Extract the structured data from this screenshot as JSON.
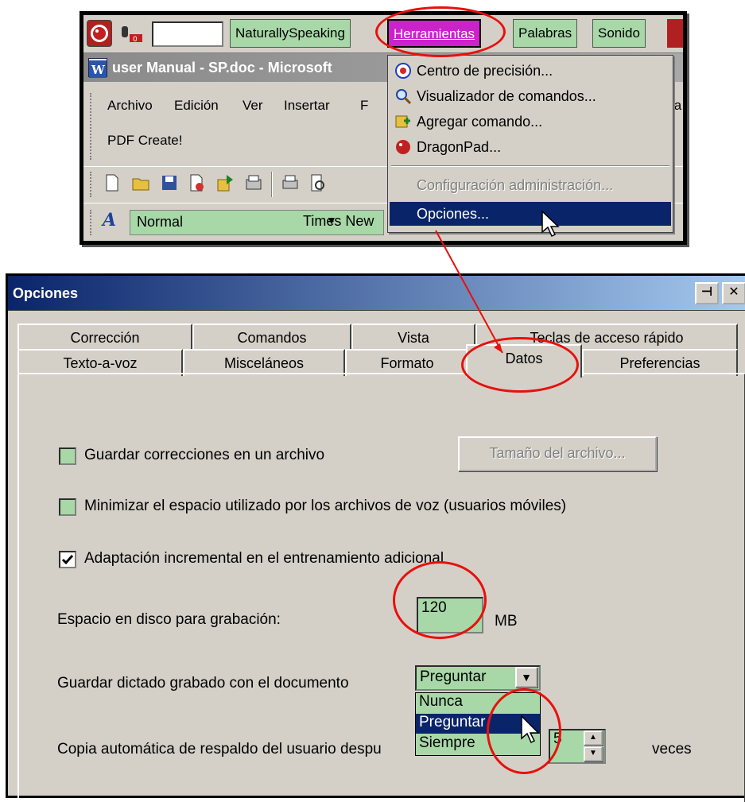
{
  "dragon_bar": {
    "menus": [
      "NaturallySpeaking",
      "Herramientas",
      "Palabras",
      "Sonido"
    ],
    "naturally_speaking": "NaturallySpeaking",
    "herramientas": "Herramientas",
    "palabras": "Palabras",
    "sonido": "Sonido",
    "herramientas_color": "#cc22cc"
  },
  "word": {
    "title": "user Manual - SP.doc - Microsoft",
    "menus": {
      "archivo": "Archivo",
      "edicion": "Edición",
      "ver": "Ver",
      "insertar": "Insertar",
      "f": "F",
      "ta": "ta",
      "pdf_create": "PDF Create!"
    },
    "style_value": "Normal",
    "font_value": "Times New"
  },
  "tools_menu": {
    "items": [
      {
        "label": "Centro de precisión...",
        "icon": "target-icon"
      },
      {
        "label": "Visualizador de comandos...",
        "icon": "magnifier-icon"
      },
      {
        "label": "Agregar comando...",
        "icon": "add-command-icon"
      },
      {
        "label": "DragonPad...",
        "icon": "dragon-icon"
      },
      {
        "label": "Configuración administración...",
        "disabled": true
      },
      {
        "label": "Opciones...",
        "selected": true
      }
    ],
    "highlight_color": "#0a246a"
  },
  "dialog": {
    "title": "Opciones",
    "tabs_row1": [
      "Corrección",
      "Comandos",
      "Vista",
      "Teclas de acceso rápido"
    ],
    "tabs_row2": [
      "Texto-a-voz",
      "Misceláneos",
      "Formato",
      "Datos",
      "Preferencias"
    ],
    "active_tab": "Datos",
    "guardar_correcciones": {
      "label": "Guardar correcciones en un archivo",
      "checked": false
    },
    "tamano_button": "Tamaño del archivo...",
    "minimizar": {
      "label": "Minimizar el espacio utilizado por los archivos de voz (usuarios móviles)",
      "checked": false
    },
    "adaptacion": {
      "label": "Adaptación incremental en el entrenamiento adicional",
      "checked": true
    },
    "espacio": {
      "label": "Espacio en disco para grabación:",
      "value": "120",
      "unit": "MB"
    },
    "guardar_dictado": {
      "label": "Guardar dictado grabado con el documento",
      "selected": "Preguntar",
      "options": [
        "Nunca",
        "Preguntar",
        "Siempre"
      ]
    },
    "copia": {
      "label": "Copia automática de respaldo del usuario despu",
      "value": "5",
      "unit": "veces"
    }
  },
  "colors": {
    "field_green": "#a8d8a8",
    "annotation_red": "#e8100c",
    "title_blue": "#0a246a"
  }
}
